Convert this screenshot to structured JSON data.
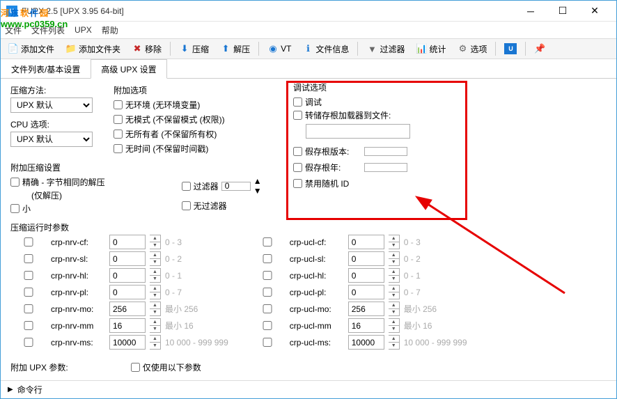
{
  "window": {
    "title": "FUPX 2.5   [UPX 3.95 64-bit]"
  },
  "watermark": {
    "text": "河东软件园",
    "url": "www.pc0359.cn"
  },
  "menu": {
    "file": "文件",
    "filelist": "文件列表",
    "upx": "UPX",
    "help": "帮助"
  },
  "toolbar": {
    "addfile": "添加文件",
    "addfolder": "添加文件夹",
    "remove": "移除",
    "compress": "压缩",
    "decompress": "解压",
    "vt": "VT",
    "fileinfo": "文件信息",
    "filter": "过滤器",
    "stats": "统计",
    "options": "选项"
  },
  "tabs": {
    "basic": "文件列表/基本设置",
    "adv": "高级 UPX 设置"
  },
  "compress": {
    "method_lbl": "压缩方法:",
    "method_val": "UPX 默认",
    "cpu_lbl": "CPU 选项:",
    "cpu_val": "UPX 默认"
  },
  "addopt": {
    "legend": "附加选项",
    "noenv": "无环境 (无环境变量)",
    "nomode": "无模式 (不保留模式 (权限))",
    "noowner": "无所有者 (不保留所有权)",
    "notime": "无时间 (不保留时间戳)"
  },
  "addcomp": {
    "legend": "附加压缩设置",
    "exact": "精确 - 字节相同的解压",
    "only": "(仅解压)",
    "small": "小",
    "filter_lbl": "过滤器",
    "filter_val": "0",
    "nofilter": "无过滤器"
  },
  "debug": {
    "legend": "调试选项",
    "debug": "调试",
    "dump": "转储存根加载器到文件:",
    "fakever": "假存根版本:",
    "fakeyear": "假存根年:",
    "norand": "禁用随机 ID"
  },
  "runtime": {
    "legend": "压缩运行时参数"
  },
  "params": {
    "nrv": [
      {
        "name": "crp-nrv-cf:",
        "val": "0",
        "hint": "0 - 3"
      },
      {
        "name": "crp-nrv-sl:",
        "val": "0",
        "hint": "0 - 2"
      },
      {
        "name": "crp-nrv-hl:",
        "val": "0",
        "hint": "0 - 1"
      },
      {
        "name": "crp-nrv-pl:",
        "val": "0",
        "hint": "0 - 7"
      },
      {
        "name": "crp-nrv-mo:",
        "val": "256",
        "hint": "最小 256"
      },
      {
        "name": "crp-nrv-mm",
        "val": "16",
        "hint": "最小 16"
      },
      {
        "name": "crp-nrv-ms:",
        "val": "10000",
        "hint": "10 000 - 999 999"
      }
    ],
    "ucl": [
      {
        "name": "crp-ucl-cf:",
        "val": "0",
        "hint": "0 - 3"
      },
      {
        "name": "crp-ucl-sl:",
        "val": "0",
        "hint": "0 - 2"
      },
      {
        "name": "crp-ucl-hl:",
        "val": "0",
        "hint": "0 - 1"
      },
      {
        "name": "crp-ucl-pl:",
        "val": "0",
        "hint": "0 - 7"
      },
      {
        "name": "crp-ucl-mo:",
        "val": "256",
        "hint": "最小 256"
      },
      {
        "name": "crp-ucl-mm",
        "val": "16",
        "hint": "最小 16"
      },
      {
        "name": "crp-ucl-ms:",
        "val": "10000",
        "hint": "10 000 - 999 999"
      }
    ]
  },
  "addparams": {
    "label": "附加 UPX 参数:",
    "onlyuse": "仅使用以下参数"
  },
  "cmdline": {
    "label": "命令行"
  }
}
